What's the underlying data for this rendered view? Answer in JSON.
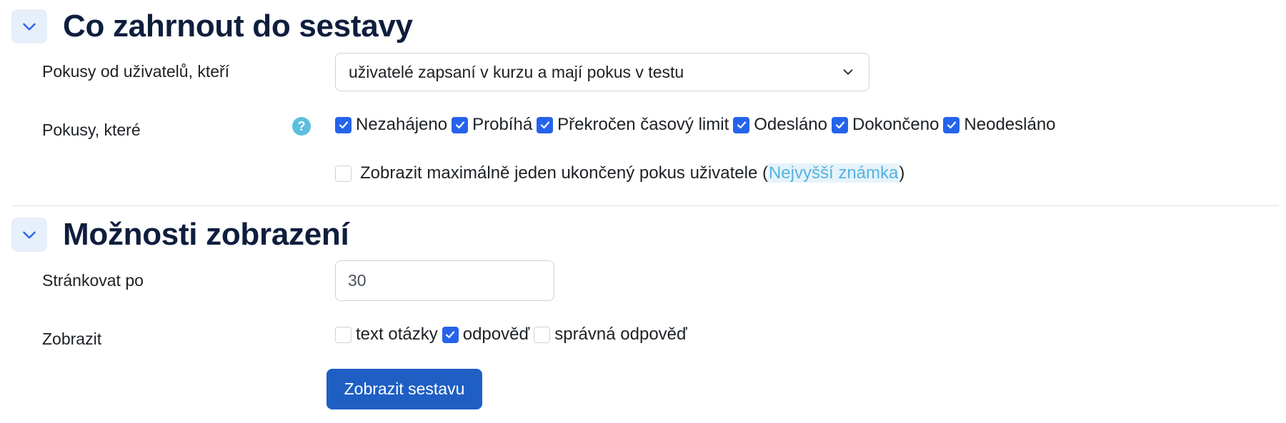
{
  "section1": {
    "title": "Co zahrnout do sestavy",
    "attempts_from_label": "Pokusy od uživatelů, kteří",
    "attempts_from_value": "uživatelé zapsaní v kurzu a mají pokus v testu",
    "attempts_that_label": "Pokusy, které",
    "help_symbol": "?",
    "states": [
      {
        "label": "Nezahájeno",
        "checked": true
      },
      {
        "label": "Probíhá",
        "checked": true
      },
      {
        "label": "Překročen časový limit",
        "checked": true
      },
      {
        "label": "Odesláno",
        "checked": true
      },
      {
        "label": "Dokončeno",
        "checked": true
      },
      {
        "label": "Neodesláno",
        "checked": true
      }
    ],
    "onlyone_text": "Zobrazit maximálně jeden ukončený pokus uživatele (",
    "onlyone_link": "Nejvyšší známka",
    "onlyone_close": ")",
    "onlyone_checked": false
  },
  "section2": {
    "title": "Možnosti zobrazení",
    "pagesize_label": "Stránkovat po",
    "pagesize_value": "30",
    "show_label": "Zobrazit",
    "show_options": [
      {
        "label": "text otázky",
        "checked": false
      },
      {
        "label": "odpověď",
        "checked": true
      },
      {
        "label": "správná odpověď",
        "checked": false
      }
    ]
  },
  "submit_label": "Zobrazit sestavu",
  "colors": {
    "accent": "#2563eb",
    "button": "#1f5fc4",
    "link": "#54b3e0",
    "help": "#5bc0de"
  }
}
